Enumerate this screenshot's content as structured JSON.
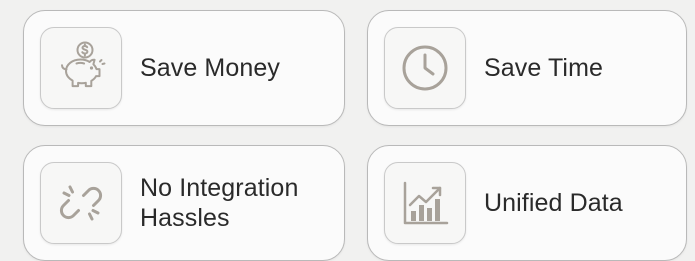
{
  "colors": {
    "background": "#f1f1f0",
    "card": "#fbfbfb",
    "border": "#b9b9b9",
    "icon": "#a8a29a",
    "text": "#2a2a2a"
  },
  "cards": [
    {
      "label": "Save Money",
      "icon": "piggy-bank-dollar-icon"
    },
    {
      "label": "Save Time",
      "icon": "clock-icon"
    },
    {
      "label_lines": [
        "No Integration",
        "Hassles"
      ],
      "icon": "broken-chain-link-icon"
    },
    {
      "label": "Unified Data",
      "icon": "bar-chart-growth-icon"
    }
  ]
}
